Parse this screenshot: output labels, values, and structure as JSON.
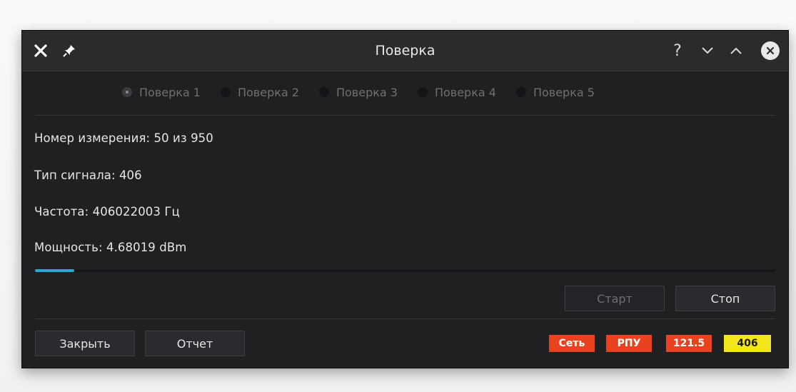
{
  "window": {
    "title": "Поверка",
    "controls": {
      "help_glyph": "?",
      "minimize_glyph": "⌄",
      "maximize_glyph": "⌃"
    }
  },
  "tabs": [
    {
      "label": "Поверка 1",
      "active": true
    },
    {
      "label": "Поверка 2",
      "active": false
    },
    {
      "label": "Поверка 3",
      "active": false
    },
    {
      "label": "Поверка 4",
      "active": false
    },
    {
      "label": "Поверка 5",
      "active": false
    }
  ],
  "measurement": {
    "number": "Номер измерения: 50 из 950",
    "signal_type": "Тип сигнала: 406",
    "frequency": "Частота: 406022003 Гц",
    "power": "Мощность: 4.68019 dBm"
  },
  "progress": {
    "fraction": 0.053
  },
  "buttons": {
    "start": "Старт",
    "stop": "Стоп",
    "close": "Закрыть",
    "report": "Отчет"
  },
  "status_badges": [
    {
      "label": "Сеть",
      "bg": "#e8421f",
      "fg": "#ffffff"
    },
    {
      "label": "РПУ",
      "bg": "#e8421f",
      "fg": "#ffffff"
    },
    {
      "label": "121.5",
      "bg": "#e8421f",
      "fg": "#ffffff"
    },
    {
      "label": "406",
      "bg": "#f4e61c",
      "fg": "#1a1a1a"
    }
  ],
  "colors": {
    "accent": "#2aa7d6",
    "window_bg": "#1f2022",
    "titlebar_bg": "#2a2b2d"
  },
  "icons": {
    "close_left": "close-x-icon",
    "pin": "pin-icon",
    "help": "help-icon",
    "minimize": "chevron-down-icon",
    "maximize": "chevron-up-icon",
    "close_right": "close-circle-icon"
  }
}
